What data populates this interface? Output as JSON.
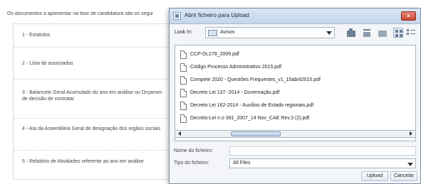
{
  "background": {
    "intro": "Os documentos a apresentar na fase de candidatura são os segui",
    "rows": [
      "1 - Estatutos",
      "2 - Lista de associados",
      "3 - Balancete Geral Acumulado do ano em análise ou Orçamen",
      "de decisão de contratar",
      "4 - Ata da Assembleia Geral de designação dos orgãos sociais",
      "5 - Relatório de Atividades referente ao ano em análise"
    ]
  },
  "dialog": {
    "title": "Abrir ficheiro para Upload",
    "close_glyph": "×",
    "look_in_label": "Look In:",
    "look_in_value": "Avisos",
    "files": [
      "CCP-DL278_2009.pdf",
      "Código Processo Administrativo 2015.pdf",
      "Compete 2020 - Questões Frequentes_v1_15abril2015.pdf",
      "Decreto Lei 137 -2014 - Governação.pdf",
      "Decreto Lei 162-2014 - Auxílios de Estado regionais.pdf",
      "Decreto-Lei n.o 381_2007_14 Nov_CAE Rev.3 (2).pdf"
    ],
    "file_name_label": "Nome do ficheiro:",
    "file_name_value": "",
    "file_type_label": "Tipo do ficheiro:",
    "file_type_value": "All Files",
    "upload_button": "Upload",
    "cancel_button": "Cancelar",
    "toolbar_icons": [
      "up-folder-icon",
      "home-icon",
      "new-folder-icon",
      "list-view-icon",
      "details-view-icon"
    ]
  }
}
